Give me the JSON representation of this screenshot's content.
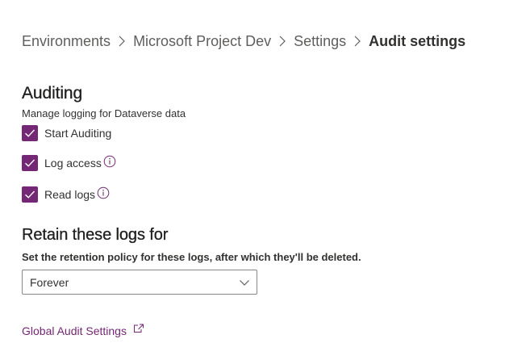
{
  "breadcrumb": {
    "items": [
      {
        "label": "Environments"
      },
      {
        "label": "Microsoft Project Dev"
      },
      {
        "label": "Settings"
      },
      {
        "label": "Audit settings"
      }
    ]
  },
  "auditing": {
    "title": "Auditing",
    "description": "Manage logging for Dataverse data",
    "options": [
      {
        "label": "Start Auditing",
        "checked": true,
        "info": false
      },
      {
        "label": "Log access",
        "checked": true,
        "info": true
      },
      {
        "label": "Read logs",
        "checked": true,
        "info": true
      }
    ]
  },
  "retention": {
    "title": "Retain these logs for",
    "description": "Set the retention policy for these logs, after which they'll be deleted.",
    "selected": "Forever"
  },
  "link": {
    "label": "Global Audit Settings"
  },
  "colors": {
    "accent": "#742774",
    "text": "#323130",
    "muted": "#605e5c"
  },
  "icons": {
    "separator": "chevron-right-icon",
    "checkbox": "checkmark-icon",
    "info": "info-icon",
    "dropdown": "chevron-down-icon",
    "external": "open-in-new-window-icon"
  }
}
